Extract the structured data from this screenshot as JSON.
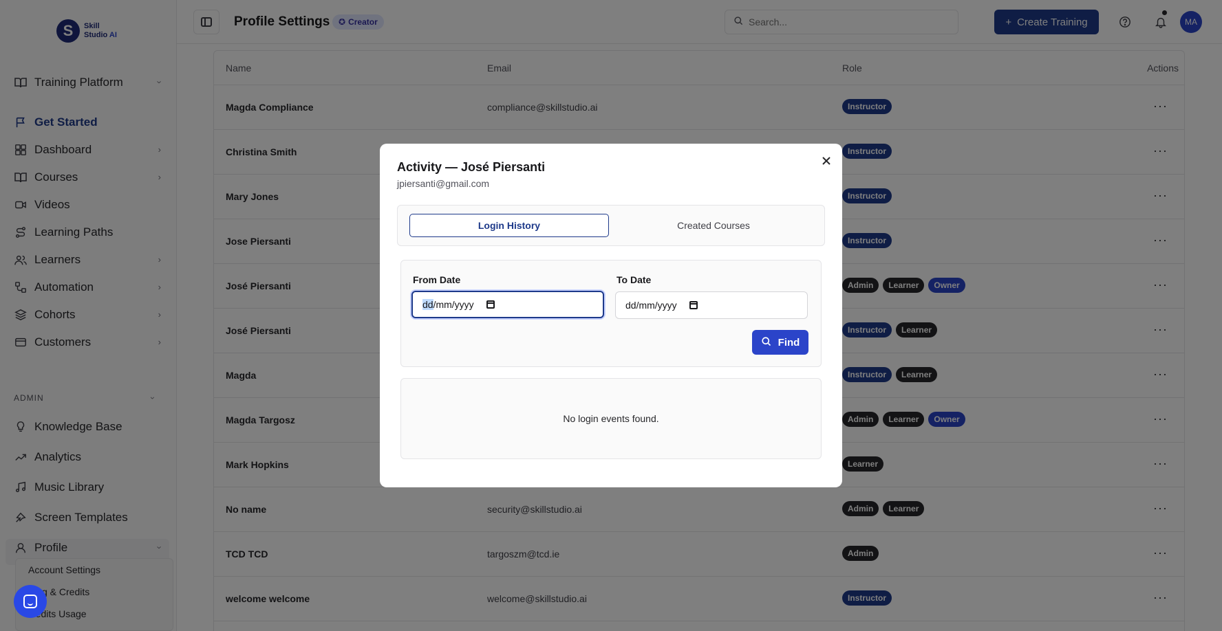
{
  "brand": {
    "name_line1": "Skill",
    "name_line2": "Studio",
    "name_ai": "AI",
    "mark": "S"
  },
  "sidebar": {
    "workspace": "Training Platform",
    "items": [
      {
        "label": "Get Started",
        "icon": "flag-icon"
      },
      {
        "label": "Dashboard",
        "icon": "grid-icon"
      },
      {
        "label": "Courses",
        "icon": "book-icon"
      },
      {
        "label": "Videos",
        "icon": "video-icon"
      },
      {
        "label": "Learning Paths",
        "icon": "route-icon"
      },
      {
        "label": "Learners",
        "icon": "users-icon"
      },
      {
        "label": "Automation",
        "icon": "workflow-icon"
      },
      {
        "label": "Cohorts",
        "icon": "layers-icon"
      },
      {
        "label": "Customers",
        "icon": "card-icon"
      }
    ],
    "admin_label": "ADMIN",
    "admin_items": [
      {
        "label": "Knowledge Base",
        "icon": "bulb-icon"
      },
      {
        "label": "Analytics",
        "icon": "trend-icon"
      },
      {
        "label": "Music Library",
        "icon": "music-icon"
      },
      {
        "label": "Screen Templates",
        "icon": "template-icon"
      }
    ],
    "profile_label": "Profile",
    "profile_sub": [
      "Account Settings",
      "ling & Credits",
      "redits Usage"
    ]
  },
  "header": {
    "title": "Profile Settings",
    "badge": "Creator",
    "search_placeholder": "Search...",
    "create_label": "Create Training",
    "avatar": "MA"
  },
  "table": {
    "columns": [
      "Name",
      "Email",
      "Role",
      "Actions"
    ],
    "rows": [
      {
        "name": "Magda Compliance",
        "email": "compliance@skillstudio.ai",
        "roles": [
          "Instructor"
        ]
      },
      {
        "name": "Christina Smith",
        "email": "",
        "roles": [
          "Instructor"
        ]
      },
      {
        "name": "Mary Jones",
        "email": "",
        "roles": [
          "Instructor"
        ]
      },
      {
        "name": "Jose Piersanti",
        "email": "",
        "roles": [
          "Instructor"
        ]
      },
      {
        "name": "José Piersanti",
        "email": "",
        "roles": [
          "Admin",
          "Learner",
          "Owner"
        ]
      },
      {
        "name": "José Piersanti",
        "email": "",
        "roles": [
          "Instructor",
          "Learner"
        ]
      },
      {
        "name": "Magda",
        "email": "",
        "roles": [
          "Instructor",
          "Learner"
        ]
      },
      {
        "name": "Magda Targosz",
        "email": "",
        "roles": [
          "Admin",
          "Learner",
          "Owner"
        ]
      },
      {
        "name": "Mark Hopkins",
        "email": "",
        "roles": [
          "Learner"
        ]
      },
      {
        "name": "No name",
        "email": "security@skillstudio.ai",
        "roles": [
          "Admin",
          "Learner"
        ]
      },
      {
        "name": "TCD TCD",
        "email": "targoszm@tcd.ie",
        "roles": [
          "Admin"
        ]
      },
      {
        "name": "welcome welcome",
        "email": "welcome@skillstudio.ai",
        "roles": [
          "Instructor"
        ]
      }
    ],
    "actions_glyph": "···"
  },
  "modal": {
    "title": "Activity — José Piersanti",
    "email": "jpiersanti@gmail.com",
    "tabs": [
      "Login History",
      "Created Courses"
    ],
    "active_tab": "Login History",
    "from_label": "From Date",
    "to_label": "To Date",
    "from_value_dd": "dd",
    "from_value_rest": "/mm/yyyy",
    "to_value": "dd/mm/yyyy",
    "find_label": "Find",
    "empty_text": "No login events found."
  },
  "colors": {
    "primary": "#1e3a8a",
    "accent": "#2b44c9"
  }
}
